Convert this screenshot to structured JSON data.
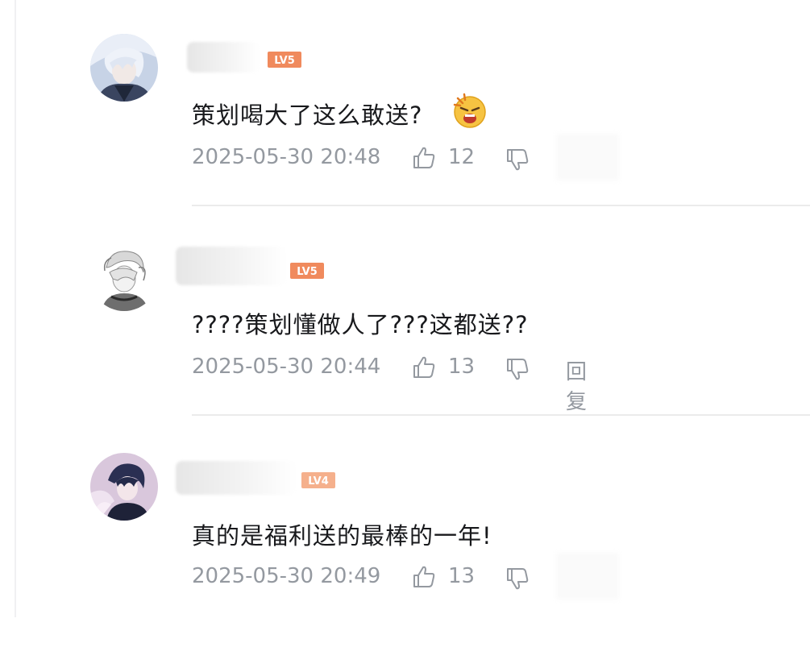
{
  "colors": {
    "text": "#18191c",
    "meta": "#9499a0",
    "divider": "#ebebeb",
    "level_badge_orange": "#f08a5d",
    "level_badge_light": "#f5b08c"
  },
  "comments": [
    {
      "level": "LV5",
      "text": "策划喝大了这么敢送?",
      "emoji": "shocked-face-emoji",
      "time": "2025-05-30 20:48",
      "likes": "12",
      "reply": ""
    },
    {
      "level": "LV5",
      "text": "????策划懂做人了???这都送??",
      "emoji": "",
      "time": "2025-05-30 20:44",
      "likes": "13",
      "reply": "回复"
    },
    {
      "level": "LV4",
      "text": "真的是福利送的最棒的一年!",
      "emoji": "",
      "time": "2025-05-30 20:49",
      "likes": "13",
      "reply": ""
    }
  ]
}
